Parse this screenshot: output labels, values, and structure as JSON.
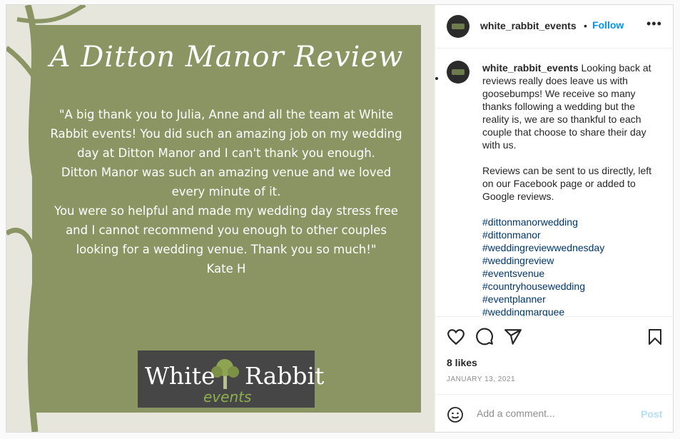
{
  "post_image": {
    "title": "A Ditton Manor Review",
    "quote_lines": [
      "\"A big thank you to Julia, Anne and all the team at White Rabbit events! You did such an amazing job on my wedding day at Ditton Manor and I can't thank you enough.",
      "Ditton Manor was such an amazing venue and we loved every minute of it.",
      "You were so helpful and made my wedding day stress free and I cannot recommend you enough to other couples looking for a wedding venue. Thank you so much!\"",
      "Kate H"
    ],
    "logo_word_1": "White",
    "logo_word_2": "Rabbit",
    "logo_events": "events"
  },
  "header": {
    "username": "white_rabbit_events",
    "separator": "•",
    "follow_label": "Follow",
    "more_label": "•••"
  },
  "caption": {
    "username": "white_rabbit_events",
    "text": "Looking back at reviews really does leave us with goosebumps! We receive so many thanks following a wedding but the reality is, we are so thankful to each couple that choose to share their day with us.\n\nReviews can be sent to us directly, left on our Facebook page or added to Google reviews.",
    "hashtags": [
      "#dittonmanorwedding",
      "#dittonmanor",
      "#weddingreviewwednesday",
      "#weddingreview",
      "#eventsvenue",
      "#countryhousewedding",
      "#eventplanner",
      "#weddingmarquee"
    ]
  },
  "engagement": {
    "likes": "8 likes",
    "date": "JANUARY 13, 2021"
  },
  "comment": {
    "placeholder": "Add a comment...",
    "post_label": "Post"
  },
  "colors": {
    "card_green": "#8a9563",
    "follow_blue": "#0095f6",
    "hashtag_blue": "#00376b",
    "post_disabled": "#b2dffc"
  },
  "icons": [
    "heart-icon",
    "comment-icon",
    "share-icon",
    "bookmark-icon",
    "emoji-icon",
    "more-options-icon"
  ]
}
